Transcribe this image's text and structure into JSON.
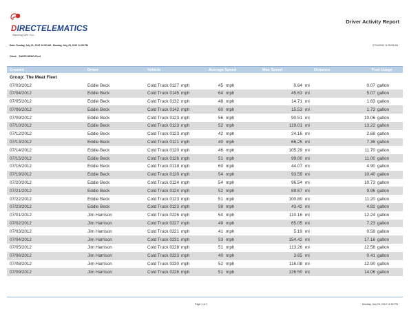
{
  "header": {
    "logo_initial": "D",
    "logo_rest": "IRECTELEMATICS",
    "tagline": "Watching Over You...",
    "report_title": "Driver Activity Report",
    "date_range": "Date: Sunday, July 01, 2012 12:00 AM - Monday, July 23, 2012 11:59 PM",
    "print_date": "07/24/2012 11:39:05 AM",
    "client": "Client: _SALES-DEMO-Fleet"
  },
  "colors": {
    "logo_blue": "#1b3f8f",
    "logo_red": "#c9302c",
    "header_band": "#b8cfe6",
    "alt_row": "#dcdcdc"
  },
  "table": {
    "columns": [
      "Created",
      "Driver",
      "Vehicle",
      "Average Speed",
      "Max Speed",
      "Distance",
      "Fuel Usage"
    ],
    "group_label": "Group: The Meat Fleet",
    "rows": [
      {
        "created": "07/03/2012",
        "driver": "Eddie Beck",
        "vehicle": "Cold Truck 01",
        "avg": "27",
        "avg_unit": "mph",
        "max": "45",
        "max_unit": "mph",
        "dist": "0.64",
        "dist_unit": "mi",
        "fuel": "0.07",
        "fuel_unit": "gallon"
      },
      {
        "created": "07/04/2012",
        "driver": "Eddie Beck",
        "vehicle": "Cold Truck 01",
        "avg": "45",
        "avg_unit": "mph",
        "max": "64",
        "max_unit": "mph",
        "dist": "45.63",
        "dist_unit": "mi",
        "fuel": "5.07",
        "fuel_unit": "gallon"
      },
      {
        "created": "07/05/2012",
        "driver": "Eddie Beck",
        "vehicle": "Cold Truck 01",
        "avg": "32",
        "avg_unit": "mph",
        "max": "48",
        "max_unit": "mph",
        "dist": "14.71",
        "dist_unit": "mi",
        "fuel": "1.63",
        "fuel_unit": "gallon"
      },
      {
        "created": "07/06/2012",
        "driver": "Eddie Beck",
        "vehicle": "Cold Truck 01",
        "avg": "42",
        "avg_unit": "mph",
        "max": "60",
        "max_unit": "mph",
        "dist": "15.53",
        "dist_unit": "mi",
        "fuel": "1.73",
        "fuel_unit": "gallon"
      },
      {
        "created": "07/09/2012",
        "driver": "Eddie Beck",
        "vehicle": "Cold Truck 01",
        "avg": "23",
        "avg_unit": "mph",
        "max": "56",
        "max_unit": "mph",
        "dist": "90.51",
        "dist_unit": "mi",
        "fuel": "10.06",
        "fuel_unit": "gallon"
      },
      {
        "created": "07/10/2012",
        "driver": "Eddie Beck",
        "vehicle": "Cold Truck 01",
        "avg": "23",
        "avg_unit": "mph",
        "max": "52",
        "max_unit": "mph",
        "dist": "119.01",
        "dist_unit": "mi",
        "fuel": "13.22",
        "fuel_unit": "gallon"
      },
      {
        "created": "07/12/2012",
        "driver": "Eddie Beck",
        "vehicle": "Cold Truck 01",
        "avg": "23",
        "avg_unit": "mph",
        "max": "42",
        "max_unit": "mph",
        "dist": "24.16",
        "dist_unit": "mi",
        "fuel": "2.68",
        "fuel_unit": "gallon"
      },
      {
        "created": "07/13/2012",
        "driver": "Eddie Beck",
        "vehicle": "Cold Truck 01",
        "avg": "21",
        "avg_unit": "mph",
        "max": "40",
        "max_unit": "mph",
        "dist": "66.25",
        "dist_unit": "mi",
        "fuel": "7.36",
        "fuel_unit": "gallon"
      },
      {
        "created": "07/14/2012",
        "driver": "Eddie Beck",
        "vehicle": "Cold Truck 01",
        "avg": "20",
        "avg_unit": "mph",
        "max": "46",
        "max_unit": "mph",
        "dist": "105.29",
        "dist_unit": "mi",
        "fuel": "11.70",
        "fuel_unit": "gallon"
      },
      {
        "created": "07/15/2012",
        "driver": "Eddie Beck",
        "vehicle": "Cold Truck 01",
        "avg": "26",
        "avg_unit": "mph",
        "max": "51",
        "max_unit": "mph",
        "dist": "99.00",
        "dist_unit": "mi",
        "fuel": "11.00",
        "fuel_unit": "gallon"
      },
      {
        "created": "07/16/2012",
        "driver": "Eddie Beck",
        "vehicle": "Cold Truck 01",
        "avg": "18",
        "avg_unit": "mph",
        "max": "60",
        "max_unit": "mph",
        "dist": "44.07",
        "dist_unit": "mi",
        "fuel": "4.90",
        "fuel_unit": "gallon"
      },
      {
        "created": "07/19/2012",
        "driver": "Eddie Beck",
        "vehicle": "Cold Truck 01",
        "avg": "20",
        "avg_unit": "mph",
        "max": "54",
        "max_unit": "mph",
        "dist": "93.59",
        "dist_unit": "mi",
        "fuel": "10.40",
        "fuel_unit": "gallon"
      },
      {
        "created": "07/20/2012",
        "driver": "Eddie Beck",
        "vehicle": "Cold Truck 01",
        "avg": "24",
        "avg_unit": "mph",
        "max": "54",
        "max_unit": "mph",
        "dist": "96.54",
        "dist_unit": "mi",
        "fuel": "10.73",
        "fuel_unit": "gallon"
      },
      {
        "created": "07/21/2012",
        "driver": "Eddie Beck",
        "vehicle": "Cold Truck 01",
        "avg": "24",
        "avg_unit": "mph",
        "max": "52",
        "max_unit": "mph",
        "dist": "89.67",
        "dist_unit": "mi",
        "fuel": "9.96",
        "fuel_unit": "gallon"
      },
      {
        "created": "07/22/2012",
        "driver": "Eddie Beck",
        "vehicle": "Cold Truck 01",
        "avg": "23",
        "avg_unit": "mph",
        "max": "51",
        "max_unit": "mph",
        "dist": "100.80",
        "dist_unit": "mi",
        "fuel": "11.20",
        "fuel_unit": "gallon"
      },
      {
        "created": "07/23/2012",
        "driver": "Eddie Beck",
        "vehicle": "Cold Truck 01",
        "avg": "23",
        "avg_unit": "mph",
        "max": "58",
        "max_unit": "mph",
        "dist": "43.42",
        "dist_unit": "mi",
        "fuel": "4.82",
        "fuel_unit": "gallon"
      },
      {
        "created": "07/01/2012",
        "driver": "Jim Harrison",
        "vehicle": "Cold Truck 02",
        "avg": "26",
        "avg_unit": "mph",
        "max": "54",
        "max_unit": "mph",
        "dist": "110.16",
        "dist_unit": "mi",
        "fuel": "12.24",
        "fuel_unit": "gallon"
      },
      {
        "created": "07/02/2012",
        "driver": "Jim Harrison",
        "vehicle": "Cold Truck 02",
        "avg": "27",
        "avg_unit": "mph",
        "max": "49",
        "max_unit": "mph",
        "dist": "65.05",
        "dist_unit": "mi",
        "fuel": "7.23",
        "fuel_unit": "gallon"
      },
      {
        "created": "07/03/2012",
        "driver": "Jim Harrison",
        "vehicle": "Cold Truck 02",
        "avg": "21",
        "avg_unit": "mph",
        "max": "41",
        "max_unit": "mph",
        "dist": "5.19",
        "dist_unit": "mi",
        "fuel": "0.58",
        "fuel_unit": "gallon"
      },
      {
        "created": "07/04/2012",
        "driver": "Jim Harrison",
        "vehicle": "Cold Truck 02",
        "avg": "31",
        "avg_unit": "mph",
        "max": "53",
        "max_unit": "mph",
        "dist": "154.42",
        "dist_unit": "mi",
        "fuel": "17.16",
        "fuel_unit": "gallon"
      },
      {
        "created": "07/05/2012",
        "driver": "Jim Harrison",
        "vehicle": "Cold Truck 02",
        "avg": "28",
        "avg_unit": "mph",
        "max": "51",
        "max_unit": "mph",
        "dist": "113.26",
        "dist_unit": "mi",
        "fuel": "12.58",
        "fuel_unit": "gallon"
      },
      {
        "created": "07/06/2012",
        "driver": "Jim Harrison",
        "vehicle": "Cold Truck 02",
        "avg": "23",
        "avg_unit": "mph",
        "max": "40",
        "max_unit": "mph",
        "dist": "3.65",
        "dist_unit": "mi",
        "fuel": "0.41",
        "fuel_unit": "gallon"
      },
      {
        "created": "07/08/2012",
        "driver": "Jim Harrison",
        "vehicle": "Cold Truck 02",
        "avg": "30",
        "avg_unit": "mph",
        "max": "52",
        "max_unit": "mph",
        "dist": "116.08",
        "dist_unit": "mi",
        "fuel": "12.90",
        "fuel_unit": "gallon"
      },
      {
        "created": "07/09/2012",
        "driver": "Jim Harrison",
        "vehicle": "Cold Truck 02",
        "avg": "26",
        "avg_unit": "mph",
        "max": "51",
        "max_unit": "mph",
        "dist": "126.50",
        "dist_unit": "mi",
        "fuel": "14.06",
        "fuel_unit": "gallon"
      }
    ]
  },
  "footer": {
    "page": "Page 1 of 2",
    "date": "Monday, July 23, 2012 11:59 PM"
  }
}
